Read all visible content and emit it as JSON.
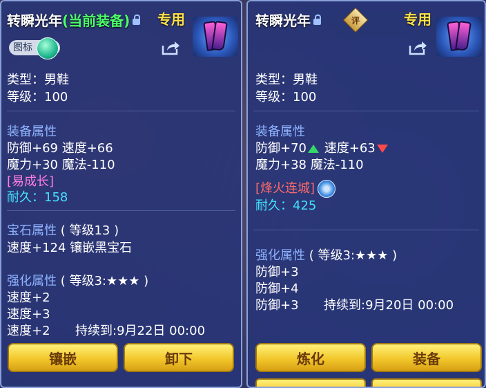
{
  "left_panel": {
    "title": "转瞬光年",
    "title_status": "(当前装备)",
    "exclusive_label": "专用",
    "chip_label": "图标",
    "type_line": "类型：男鞋",
    "level_line": "等级：100",
    "equip_attr_head": "装备属性",
    "attr_line1": "防御+69 速度+66",
    "attr_line2": "魔力+30 魔法-110",
    "special": "[易成长]",
    "durability": "耐久：158",
    "gem_head": "宝石属性",
    "gem_level": "( 等级13 )",
    "gem_line": "速度+124 镶嵌黑宝石",
    "enhance_head": "强化属性",
    "enhance_level": "( 等级3:★★★ )",
    "enhance_lines": [
      "速度+2",
      "速度+3",
      "速度+2"
    ],
    "enhance_duration": "持续到:9月22日 00:00",
    "buttons": [
      "镶嵌",
      "卸下"
    ]
  },
  "right_panel": {
    "title": "转瞬光年",
    "review_badge": "评",
    "exclusive_label": "专用",
    "type_line": "类型：男鞋",
    "level_line": "等级：100",
    "equip_attr_head": "装备属性",
    "attr_def": "防御+70",
    "attr_spd": "速度+63",
    "attr_line2": "魔力+38 魔法-110",
    "special": "[烽火连城]",
    "durability": "耐久：425",
    "enhance_head": "强化属性",
    "enhance_level": "( 等级3:★★★ )",
    "enhance_lines": [
      "防御+3",
      "防御+4",
      "防御+3"
    ],
    "enhance_duration": "持续到:9月20日 00:00",
    "buttons": [
      "炼化",
      "装备"
    ]
  },
  "colors": {
    "panel_bg": "#263478",
    "section_head": "#8fb4ff",
    "current_equip": "#4dff6a",
    "exclusive": "#ffe14a",
    "durability": "#45e2ff",
    "special_left": "#ff7ee0",
    "special_right": "#ff6a6a",
    "button": "#f2c72c"
  },
  "icons": {
    "lock": "lock-icon",
    "share": "share-icon",
    "item": "boots-icon",
    "stat_up": "arrow-up-icon",
    "stat_down": "arrow-down-icon",
    "refine": "refine-icon"
  }
}
